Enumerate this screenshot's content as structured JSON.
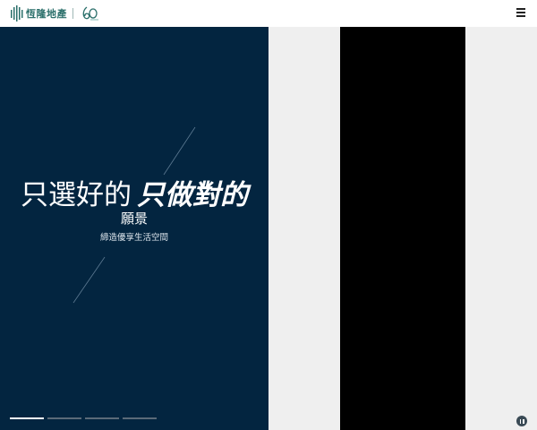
{
  "header": {
    "logo_text": "恆隆地產",
    "anniversary_mark": "60",
    "menu_icon": "hamburger-menu-icon"
  },
  "hero": {
    "headline_regular": "只選好的",
    "headline_bold": "只做對的",
    "subhead": "願景",
    "tagline": "締造優享生活空間",
    "slides_total": 4,
    "active_slide": 1
  },
  "colors": {
    "hero_bg": "#032540",
    "brand_teal": "#2a6f6a",
    "side_gray": "#efefef",
    "video_bg": "#000000"
  },
  "controls": {
    "pause_icon": "pause-icon"
  }
}
